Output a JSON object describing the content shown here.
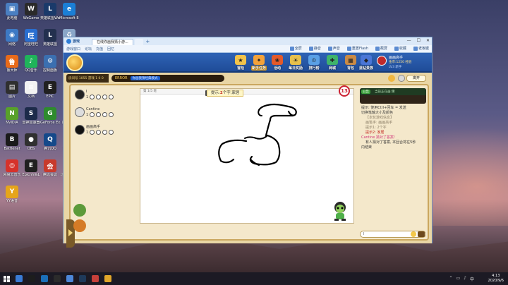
{
  "desktop": {
    "icons": [
      {
        "label": "此电脑",
        "color": "#4a7fc1",
        "glyph": "▣"
      },
      {
        "label": "WeGame",
        "color": "#2a2a2a",
        "glyph": "W"
      },
      {
        "label": "英雄联盟WeGame版",
        "color": "#1a3a6a",
        "glyph": "L"
      },
      {
        "label": "Microsoft Edge",
        "color": "#1b7fd6",
        "glyph": "e"
      },
      {
        "label": "网络",
        "color": "#3d79c4",
        "glyph": "◉"
      },
      {
        "label": "阿里旺旺",
        "color": "#2a6fd0",
        "glyph": "旺"
      },
      {
        "label": "英雄联盟",
        "color": "#23304f",
        "glyph": "L"
      },
      {
        "label": "回收站",
        "color": "#8aa6c8",
        "glyph": "♻"
      },
      {
        "label": "鲁大师",
        "color": "#e86a1a",
        "glyph": "鲁"
      },
      {
        "label": "QQ音乐",
        "color": "#1fb45a",
        "glyph": "♪"
      },
      {
        "label": "控制面板",
        "color": "#3b6fb0",
        "glyph": "⚙"
      },
      {
        "label": "QQ游戏",
        "color": "#e6702a",
        "glyph": "Q"
      },
      {
        "label": "图片",
        "color": "#2f2f2f",
        "glyph": "▤"
      },
      {
        "label": "文档",
        "color": "#f2f2f2",
        "glyph": "≡"
      },
      {
        "label": "EPIC",
        "color": "#202020",
        "glyph": "E"
      },
      {
        "label": "QQ",
        "color": "#d32f2f",
        "glyph": "Q"
      },
      {
        "label": "NVIDIA",
        "color": "#58a12a",
        "glyph": "N"
      },
      {
        "label": "雷神加速器",
        "color": "#1d2b4a",
        "glyph": "S"
      },
      {
        "label": "GeForce Experience",
        "color": "#2e8b2e",
        "glyph": "G"
      },
      {
        "label": "腾讯视频",
        "color": "#2a7fd6",
        "glyph": "▶"
      },
      {
        "label": "Battlenet",
        "color": "#1a1a1a",
        "glyph": "B"
      },
      {
        "label": "OBS",
        "color": "#303030",
        "glyph": "●"
      },
      {
        "label": "腾讯QQ",
        "color": "#15498a",
        "glyph": "Q"
      },
      {
        "label": "Steam",
        "color": "#1b2a3e",
        "glyph": "S"
      },
      {
        "label": "网易云音乐",
        "color": "#d6322b",
        "glyph": "◎"
      },
      {
        "label": "Epicnhl&L",
        "color": "#202020",
        "glyph": "E"
      },
      {
        "label": "腾讯会议",
        "color": "#c83a2c",
        "glyph": "会"
      },
      {
        "label": "迅游加速器",
        "color": "#2c6cc1",
        "glyph": "迅"
      },
      {
        "label": "YY语音",
        "color": "#e6a51b",
        "glyph": "Y"
      }
    ]
  },
  "browser": {
    "logo_text": "游戏 ",
    "tabs": [
      "在线你画我猜小游...",
      ""
    ],
    "nav_items": [
      "游戏窗口",
      "论坛",
      "充值",
      "回忆"
    ],
    "tools": [
      "全屏",
      "静音",
      "声音",
      "重置Flash",
      "截屏",
      "收藏",
      "老板键"
    ],
    "window_controls": [
      "—",
      "☐",
      "✕"
    ]
  },
  "game": {
    "top_buttons": [
      {
        "label": "冒险",
        "color": "#f2c34a",
        "glyph": "★"
      },
      {
        "label": "新手任务",
        "color": "#f3a23a",
        "glyph": "✦",
        "highlight": true
      },
      {
        "label": "活动",
        "color": "#e45a2a",
        "glyph": "❀"
      },
      {
        "label": "每日奖励",
        "color": "#e7c04c",
        "glyph": "☀"
      },
      {
        "label": "排行榜",
        "color": "#5aa0e6",
        "glyph": "♔"
      },
      {
        "label": "商城",
        "color": "#3fb36b",
        "glyph": "✚"
      },
      {
        "label": "背包",
        "color": "#c98a45",
        "glyph": "▦"
      },
      {
        "label": "蓝钻贵族",
        "color": "#4a76d6",
        "glyph": "◆"
      }
    ],
    "user": {
      "name": "画画高手",
      "stats": "金币:1250 经验",
      "extra": "LV3 新手"
    },
    "room": {
      "left_text": "房间号 1055 游戏 1 0 0",
      "title_label": "ERROR",
      "title_pill": "你画我猜经典模式",
      "exit_label": "离开"
    },
    "players": [
      {
        "name": "I",
        "level": "1",
        "avatar_color": "#222"
      },
      {
        "name": "Cantine",
        "level": "1",
        "avatar_color": "#dddddd"
      },
      {
        "name": "画画高手",
        "level": "1",
        "avatar_color": "#111"
      }
    ],
    "canvas": {
      "round_label": "第 1/5 轮",
      "hint_prefix": "提示:",
      "hint_count": "2",
      "hint_suffix": "个字,家居",
      "timer": "13"
    },
    "chat": {
      "banner_tag": "公告",
      "banner_text": "当前正在画:猜",
      "lines": [
        {
          "text": "提示: 使用Ctrl+回车 = 发送",
          "cls": "sys"
        },
        {
          "text": "切换笔触大小及颜色",
          "cls": "sys"
        },
        {
          "text": "    【本轮游戏信息】",
          "cls": "dim ind"
        },
        {
          "text": "画笔手: 画画高手",
          "cls": "dim ind"
        },
        {
          "text": "提示1: 2个字",
          "cls": "dim ind"
        },
        {
          "text": "提示2: 家居",
          "cls": "red ind"
        },
        {
          "text": "Cantine 猜对了答案!",
          "cls": "pink"
        },
        {
          "text": "  有人猜对了答案, 本回合将在5秒",
          "cls": "ind"
        },
        {
          "text": "内结束",
          "cls": ""
        }
      ],
      "input_placeholder": "I"
    }
  },
  "taskbar": {
    "apps": [
      "#3a7bd5",
      "#1d1d1d",
      "#1b6fb8",
      "#2b2b2b",
      "#4d87d8",
      "#1f3a5a",
      "#c6403a",
      "#e0a62a"
    ],
    "time": "4:13",
    "date": "2020/9/6"
  }
}
